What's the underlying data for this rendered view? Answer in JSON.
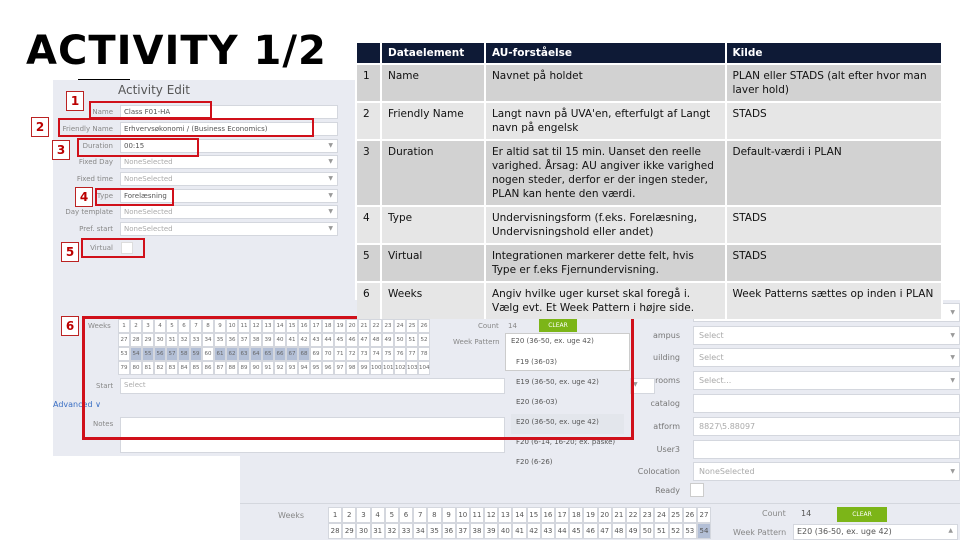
{
  "slide": {
    "title": "ACTIVITY 1/2"
  },
  "form": {
    "heading": "Activity Edit",
    "fields": [
      {
        "label": "Name",
        "value": "Class F01-HA",
        "placeholder": false,
        "dropdown": false
      },
      {
        "label": "Friendly Name",
        "value": "Erhvervsøkonomi / (Business Economics)",
        "placeholder": false,
        "dropdown": false
      },
      {
        "label": "Duration",
        "value": "00:15",
        "placeholder": false,
        "dropdown": true
      },
      {
        "label": "Fixed Day",
        "value": "NoneSelected",
        "placeholder": true,
        "dropdown": true
      },
      {
        "label": "Fixed time",
        "value": "NoneSelected",
        "placeholder": true,
        "dropdown": true
      },
      {
        "label": "Type",
        "value": "Forelæsning",
        "placeholder": false,
        "dropdown": true
      },
      {
        "label": "Day template",
        "value": "NoneSelected",
        "placeholder": true,
        "dropdown": true
      },
      {
        "label": "Pref. start",
        "value": "NoneSelected",
        "placeholder": true,
        "dropdown": true
      }
    ],
    "virtual_label": "Virtual",
    "virtual_checked": false,
    "weeks_label": "Weeks",
    "weeks_selected": [
      54,
      55,
      56,
      57,
      58,
      59,
      61,
      62,
      63,
      64,
      65,
      66,
      67,
      68
    ],
    "count_label": "Count",
    "count_value": "14",
    "clear_label": "CLEAR",
    "week_pattern_label": "Week Pattern",
    "week_pattern_value": "E20 (36-50, ex. uge 42)",
    "week_pattern_options": [
      "F19 (36-03)",
      "E19 (36-50, ex. uge 42)",
      "E20 (36-03)",
      "E20 (36-50, ex. uge 42)",
      "F20 (6-14, 16-20; ex. påske)",
      "F20 (6-26)"
    ],
    "week_pattern_highlighted": "E20 (36-50, ex. uge 42)",
    "start_label": "Start",
    "start_placeholder": "Select",
    "advanced_label": "Advanced",
    "notes_label": "Notes"
  },
  "callouts": [
    "1",
    "2",
    "3",
    "4",
    "5",
    "6"
  ],
  "table": {
    "headers": [
      "",
      "Dataelement",
      "AU-forståelse",
      "Kilde"
    ],
    "rows": [
      [
        "1",
        "Name",
        "Navnet på holdet",
        "PLAN eller STADS (alt efter hvor man laver hold)"
      ],
      [
        "2",
        "Friendly Name",
        "Langt navn på UVA'en, efterfulgt af Langt navn på engelsk",
        "STADS"
      ],
      [
        "3",
        "Duration",
        "Er altid sat til 15 min. Uanset den reelle varighed. Årsag: AU angiver ikke varighed nogen steder, derfor er der ingen steder, PLAN kan hente den værdi.",
        "Default-værdi i PLAN"
      ],
      [
        "4",
        "Type",
        "Undervisningsform (f.eks. Forelæsning, Undervisningshold eller andet)",
        "STADS"
      ],
      [
        "5",
        "Virtual",
        "Integrationen markerer dette felt, hvis Type er f.eks Fjernundervisning.",
        "STADS"
      ],
      [
        "6",
        "Weeks",
        "Angiv hvilke uger kurset skal foregå i. Vælg evt. Et Week Pattern i højre side.",
        "Week Patterns sættes op inden i PLAN"
      ]
    ]
  },
  "lower": {
    "fields": [
      {
        "label": "mPool",
        "value": "NoneSelected",
        "dropdown": true
      },
      {
        "label": "ampus",
        "value": "Select",
        "dropdown": true
      },
      {
        "label": "uilding",
        "value": "Select",
        "dropdown": true
      },
      {
        "label": "rooms",
        "value": "Select...",
        "dropdown": true
      },
      {
        "label": "catalog",
        "value": "",
        "dropdown": false
      },
      {
        "label": "atform",
        "value": "8827\\5.88097",
        "dropdown": false
      },
      {
        "label": "User3",
        "value": "",
        "dropdown": false
      },
      {
        "label": "Colocation",
        "value": "NoneSelected",
        "dropdown": true
      }
    ],
    "ready_label": "Ready",
    "weeks_label": "Weeks",
    "weeks_selected": [
      54
    ],
    "count_label": "Count",
    "count_value": "14",
    "clear_label": "CLEAR",
    "week_pattern_label": "Week Pattern",
    "week_pattern_value": "E20 (36-50, ex. uge 42)"
  },
  "colors": {
    "highlight": "#d0101a",
    "header": "#0e1a36",
    "clear_button": "#7cb518",
    "week_selected": "#b3bfd6"
  }
}
